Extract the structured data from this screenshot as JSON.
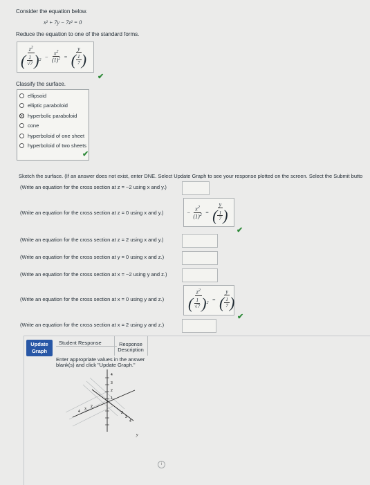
{
  "intro": "Consider the equation below.",
  "equation": "x² + 7y − 7z² = 0",
  "reduce_prompt": "Reduce the equation to one of the standard forms.",
  "standard_form": {
    "z2": "z",
    "x2": "x",
    "y": "y",
    "one": "1",
    "seven": "7",
    "sqrt7": "√7",
    "sq": "2",
    "minus": "−",
    "eq": "="
  },
  "classify_prompt": "Classify the surface.",
  "options": [
    {
      "label": "ellipsoid",
      "selected": false
    },
    {
      "label": "elliptic paraboloid",
      "selected": false
    },
    {
      "label": "hyperbolic paraboloid",
      "selected": true
    },
    {
      "label": "cone",
      "selected": false
    },
    {
      "label": "hyperboloid of one sheet",
      "selected": false
    },
    {
      "label": "hyperboloid of two sheets",
      "selected": false
    }
  ],
  "sketch_prompt": "Sketch the surface. (If an answer does not exist, enter DNE. Select Update Graph to see your response plotted on the screen. Select the Submit butto",
  "cross_sections": [
    {
      "prompt": "(Write an equation for the cross section at z = −2 using x and y.)"
    },
    {
      "prompt": "(Write an equation for the cross section at z = 0 using x and y.)"
    },
    {
      "prompt": "(Write an equation for the cross section at z = 2 using x and y.)"
    },
    {
      "prompt": "(Write an equation for the cross section at y = 0 using x and z.)"
    },
    {
      "prompt": "(Write an equation for the cross section at x = −2 using y and z.)"
    },
    {
      "prompt": "(Write an equation for the cross section at x = 0 using y and z.)"
    },
    {
      "prompt": "(Write an equation for the cross section at x = 2 using y and z.)"
    }
  ],
  "graph": {
    "update_button": "Update Graph",
    "tab_student": "Student Response",
    "tab_description": "Response Description",
    "instruction": "Enter appropriate values in the answer blank(s) and click \"Update Graph.\"",
    "axis_y_label": "y",
    "ticks_z": [
      "4",
      "3",
      "2",
      "1"
    ],
    "ticks_x": [
      "4",
      "3",
      "2"
    ],
    "ticks_y": [
      "2",
      "3",
      "4"
    ],
    "info_glyph": "i"
  },
  "colors": {
    "check": "#2f8a3a",
    "button": "#2857a6"
  }
}
